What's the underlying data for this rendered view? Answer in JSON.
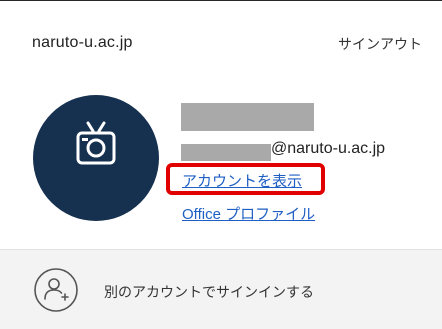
{
  "account": {
    "domain": "naruto-u.ac.jp",
    "sign_out_label": "サインアウト",
    "email_domain_suffix": "@naruto-u.ac.jp",
    "show_account_label": "アカウントを表示",
    "office_profile_label": "Office プロファイル",
    "avatar_icon": "camera-icon"
  },
  "footer": {
    "add_account_label": "別のアカウントでサインインする",
    "add_account_icon": "add-person-icon"
  },
  "colors": {
    "avatar_background": "#16304f",
    "link": "#1f5fc4",
    "highlight": "#e10000",
    "redaction": "#a9a9a9",
    "footer_background": "#f3f3f3"
  }
}
